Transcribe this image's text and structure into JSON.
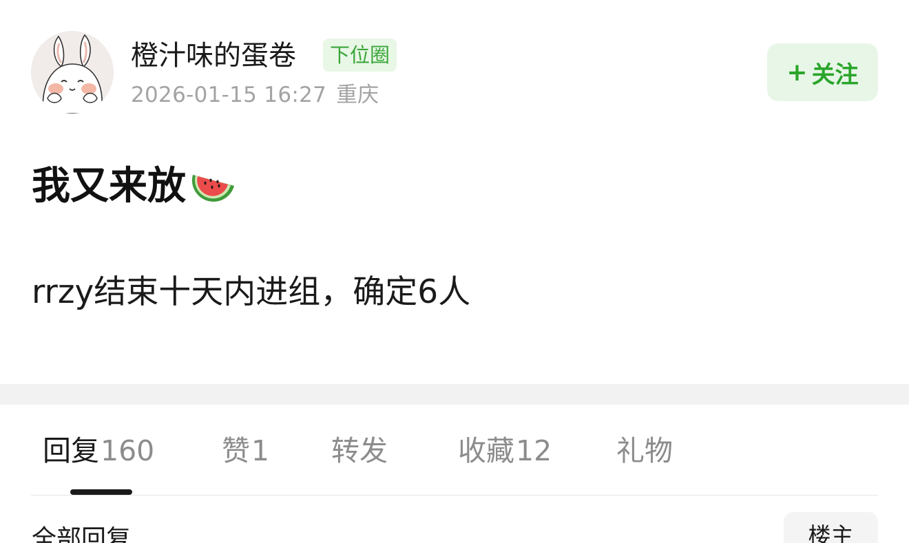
{
  "author": {
    "name": "橙汁味的蛋卷",
    "circle_badge": "下位圈",
    "timestamp": "2026-01-15 16:27",
    "location": "重庆",
    "avatar_icon": "bunny-avatar-icon"
  },
  "follow_button": {
    "plus": "+",
    "label": "关注"
  },
  "post": {
    "title": "我又来放",
    "title_emoji": "watermelon-icon",
    "body": "rrzy结束十天内进组，确定6人"
  },
  "tabs": [
    {
      "label": "回复",
      "count": "160",
      "active": true
    },
    {
      "label": "赞",
      "count": "1",
      "active": false
    },
    {
      "label": "转发",
      "count": "",
      "active": false
    },
    {
      "label": "收藏",
      "count": "12",
      "active": false
    },
    {
      "label": "礼物",
      "count": "",
      "active": false
    }
  ],
  "replies_section": {
    "title": "全部回复",
    "filter_button": "楼主"
  },
  "colors": {
    "accent_green": "#2aa52a",
    "badge_bg": "#e9f7e6",
    "follow_bg": "#e8f6e8",
    "muted_text": "#a3a3a3"
  }
}
